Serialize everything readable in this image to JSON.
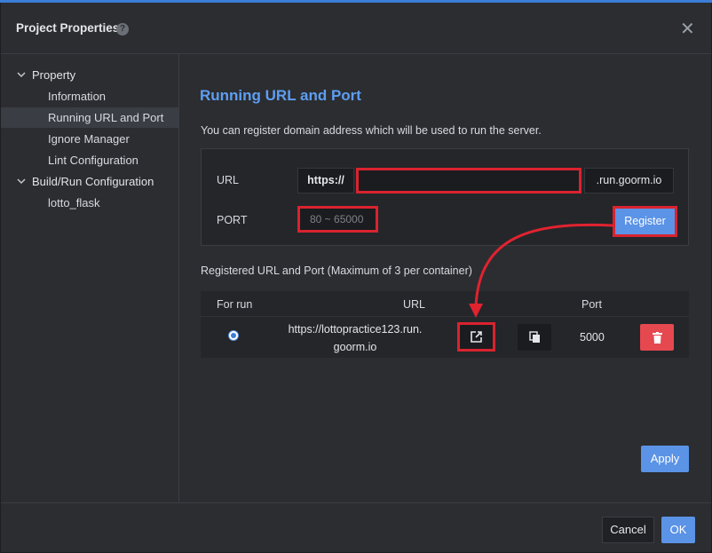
{
  "dialog": {
    "title": "Project Properties",
    "help_icon": "help-icon",
    "close_icon": "close-icon"
  },
  "sidebar": {
    "groups": [
      {
        "label": "Property",
        "expanded": true,
        "items": [
          {
            "label": "Information",
            "active": false
          },
          {
            "label": "Running URL and Port",
            "active": true
          },
          {
            "label": "Ignore Manager",
            "active": false
          },
          {
            "label": "Lint Configuration",
            "active": false
          }
        ]
      },
      {
        "label": "Build/Run Configuration",
        "expanded": true,
        "items": [
          {
            "label": "lotto_flask",
            "active": false
          }
        ]
      }
    ]
  },
  "main": {
    "title": "Running URL and Port",
    "description": "You can register domain address which will be used to run the server.",
    "form": {
      "url_label": "URL",
      "url_prefix": "https://",
      "url_value": "",
      "url_suffix": ".run.goorm.io",
      "port_label": "PORT",
      "port_placeholder": "80 ~ 65000",
      "register_label": "Register"
    },
    "registered_title": "Registered URL and Port (Maximum of 3 per container)",
    "table": {
      "headers": [
        "For run",
        "URL",
        "Port"
      ],
      "rows": [
        {
          "selected": true,
          "url": "https://lottopractice123.run.goorm.io",
          "url_line1": "https://lottopractice123.run.",
          "url_line2": "goorm.io",
          "port": "5000"
        }
      ]
    },
    "apply_label": "Apply"
  },
  "footer": {
    "cancel_label": "Cancel",
    "ok_label": "OK"
  },
  "colors": {
    "accent": "#5b93e6",
    "highlight": "#d9232f",
    "danger": "#e5484f",
    "title_blue": "#5e9ef2"
  }
}
